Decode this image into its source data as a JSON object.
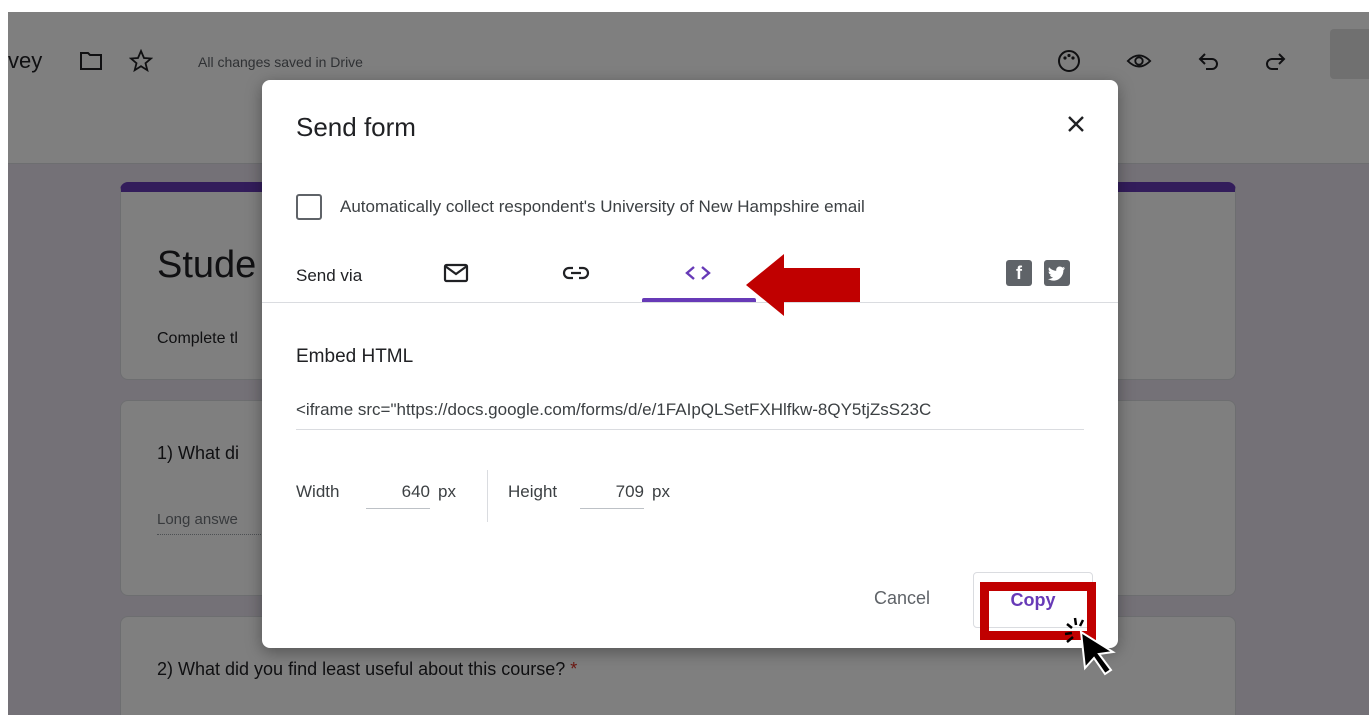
{
  "header": {
    "doc_title_fragment": "vey",
    "saved_status": "All changes saved in Drive",
    "icons": [
      "folder-icon",
      "star-icon",
      "palette-icon",
      "preview-eye-icon",
      "undo-icon",
      "redo-icon"
    ]
  },
  "form": {
    "title_fragment": "Stude",
    "description_fragment": "Complete tl",
    "question1_fragment": "1) What di",
    "long_answer_fragment": "Long answe",
    "question2": "2) What did you find least useful about this course?",
    "required_mark": "*"
  },
  "dialog": {
    "title": "Send form",
    "collect_email_label": "Automatically collect respondent's University of New Hampshire email",
    "collect_email_checked": false,
    "send_via_label": "Send via",
    "tabs": [
      {
        "name": "email",
        "icon": "mail-icon",
        "active": false
      },
      {
        "name": "link",
        "icon": "link-icon",
        "active": false
      },
      {
        "name": "embed",
        "icon": "code-icon",
        "active": true
      }
    ],
    "social": [
      {
        "name": "facebook",
        "glyph": "f"
      },
      {
        "name": "twitter",
        "glyph": "t"
      }
    ],
    "embed_heading": "Embed HTML",
    "embed_code": "<iframe src=\"https://docs.google.com/forms/d/e/1FAIpQLSetFXHlfkw-8QY5tjZsS23C",
    "width_label": "Width",
    "width_value": "640",
    "height_label": "Height",
    "height_value": "709",
    "unit": "px",
    "cancel_label": "Cancel",
    "copy_label": "Copy"
  },
  "colors": {
    "accent": "#673ab7",
    "annotation_red": "#c00000",
    "required": "#d93025"
  }
}
